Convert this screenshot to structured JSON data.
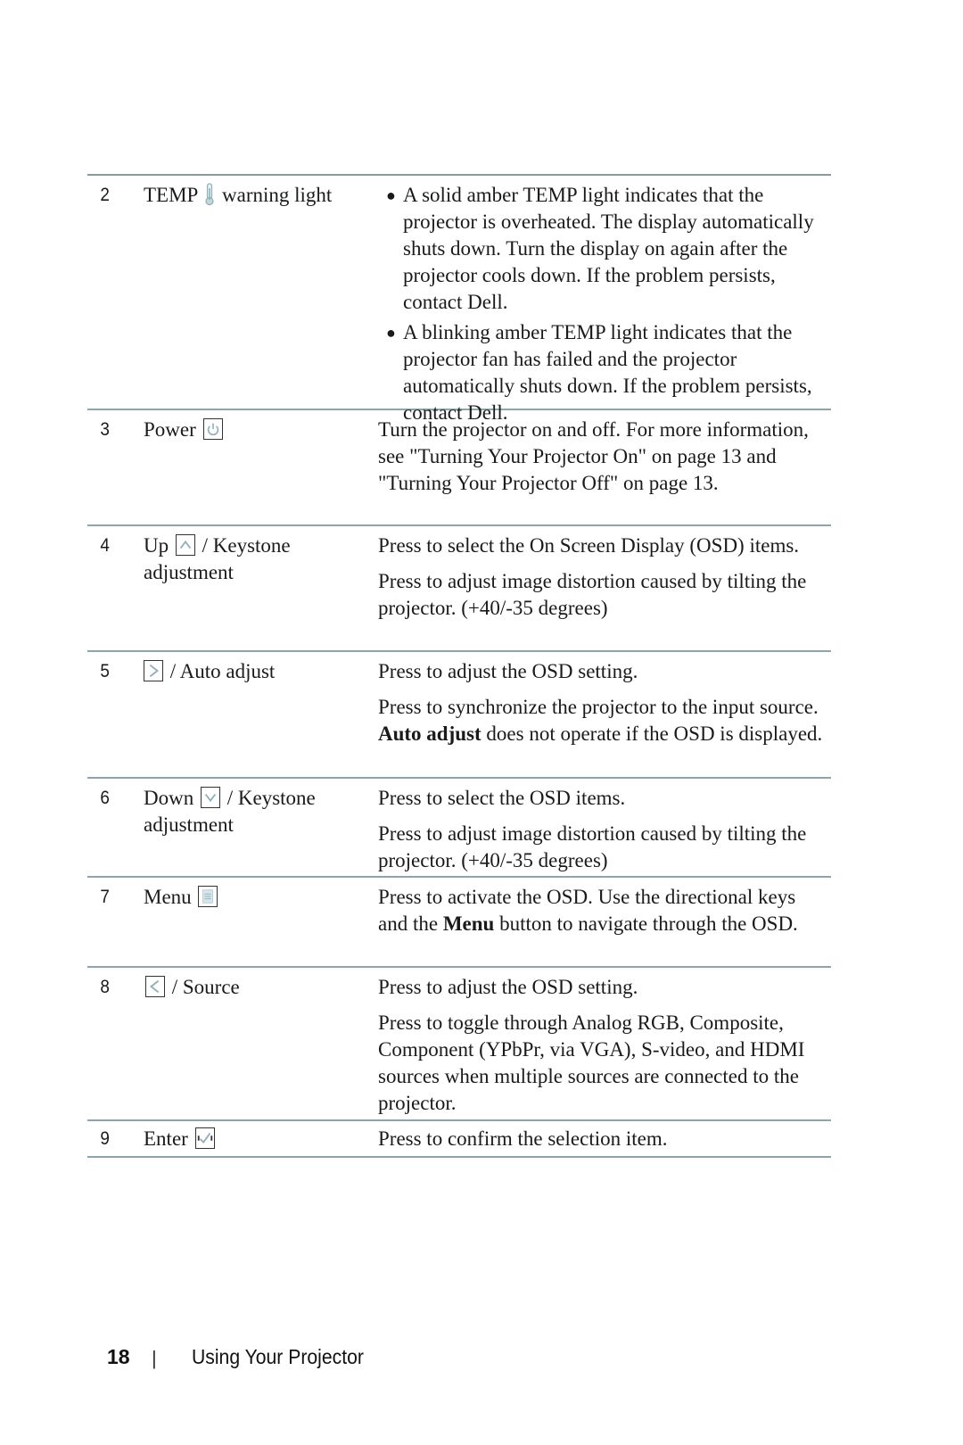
{
  "table": {
    "rows": [
      {
        "num": "2",
        "label_pre": "TEMP",
        "icon": "thermometer-icon",
        "label_post": "warning light",
        "bullets": [
          "A solid amber TEMP light indicates that the projector is overheated. The display automatically shuts down. Turn the display on again after the projector cools down. If the problem persists, contact Dell.",
          "A blinking amber TEMP light indicates that the projector fan has failed and the projector automatically shuts down. If the problem persists, contact Dell."
        ]
      },
      {
        "num": "3",
        "label_pre": "Power",
        "icon": "power-icon",
        "label_post": "",
        "paragraphs": [
          "Turn the projector on and off. For more information, see \"Turning Your Projector On\" on page 13 and \"Turning Your Projector Off\" on page 13."
        ]
      },
      {
        "num": "4",
        "label_pre": "Up",
        "icon": "up-arrow-icon",
        "label_post": "/ Keystone adjustment",
        "paragraphs": [
          "Press to select the On Screen Display (OSD) items.",
          "Press to adjust image distortion caused by tilting the projector. (+40/-35 degrees)"
        ]
      },
      {
        "num": "5",
        "label_pre": "",
        "icon": "right-arrow-icon",
        "label_post": "/ Auto adjust",
        "paragraphs": [
          "Press to adjust the OSD setting."
        ],
        "p2_pre": "Press to synchronize the projector to the input source. ",
        "p2_bold": "Auto adjust",
        "p2_post": " does not operate if the OSD is displayed."
      },
      {
        "num": "6",
        "label_pre": "Down",
        "icon": "down-arrow-icon",
        "label_post": "/ Keystone adjustment",
        "paragraphs": [
          "Press to select the OSD items.",
          "Press to adjust image distortion caused by tilting the projector. (+40/-35 degrees)"
        ]
      },
      {
        "num": "7",
        "label_pre": "Menu",
        "icon": "menu-icon",
        "label_post": "",
        "p_pre": "Press to activate the OSD. Use the directional keys and the ",
        "p_bold": "Menu",
        "p_post": " button to navigate through the OSD."
      },
      {
        "num": "8",
        "label_pre": "",
        "icon": "left-arrow-icon",
        "label_post": "/ Source",
        "paragraphs": [
          "Press to adjust the OSD setting.",
          "Press to toggle through Analog RGB, Composite, Component (YPbPr, via VGA), S-video, and HDMI sources when multiple sources are connected to the projector."
        ]
      },
      {
        "num": "9",
        "label_pre": "Enter",
        "icon": "enter-check-icon",
        "label_post": "",
        "paragraphs": [
          "Press to confirm the selection item."
        ]
      }
    ]
  },
  "footer": {
    "page_number": "18",
    "separator": "|",
    "section_title": "Using Your Projector"
  },
  "colors": {
    "icon_accent": "#8fb0b8",
    "rule": "#8fa6a8"
  }
}
